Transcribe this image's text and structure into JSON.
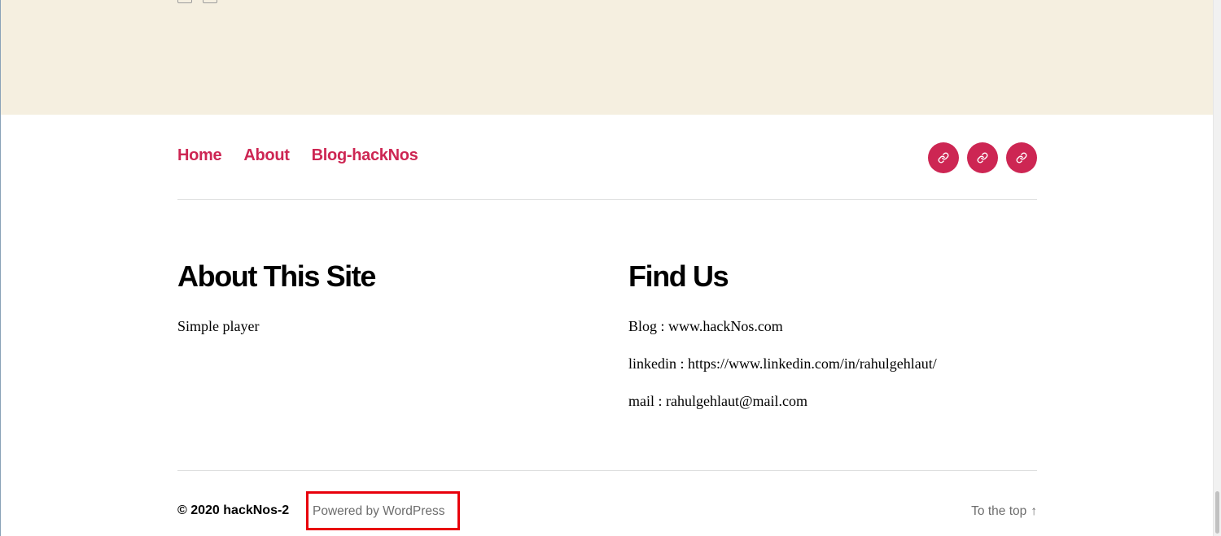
{
  "header_nav": {
    "links": [
      "Home",
      "About",
      "Blog-hackNos"
    ]
  },
  "social": {
    "icons": [
      "link-icon",
      "link-icon",
      "link-icon"
    ],
    "color": "#cd2653"
  },
  "widgets": {
    "about": {
      "title": "About This Site",
      "text": "Simple player"
    },
    "find_us": {
      "title": "Find Us",
      "blog": "Blog : www.hackNos.com",
      "linkedin": "linkedin : https://www.linkedin.com/in/rahulgehlaut/",
      "mail": "mail : rahulgehlaut@mail.com"
    }
  },
  "footer": {
    "copyright": "© 2020 hackNos-2",
    "powered_by": "Powered by WordPress",
    "to_top": "To the top",
    "to_top_arrow": "↑"
  },
  "colors": {
    "accent": "#cd2653",
    "band": "#f5efe0",
    "highlight": "#e8000b"
  }
}
